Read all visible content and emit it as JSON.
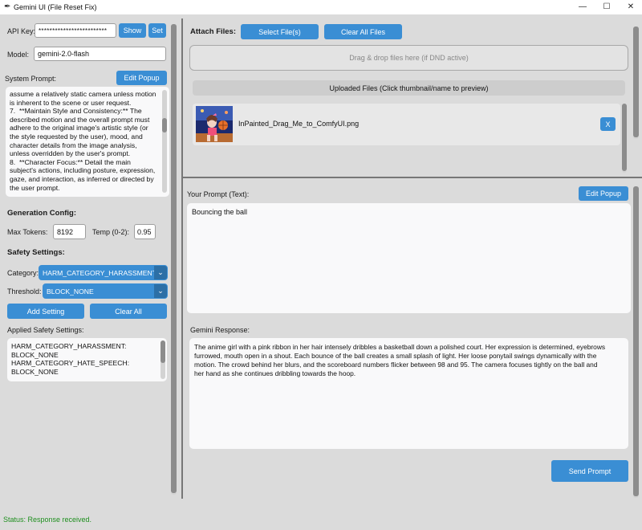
{
  "window": {
    "title": "Gemini UI (File Reset Fix)",
    "icon": "feather-icon",
    "controls": {
      "minimize": "—",
      "maximize": "☐",
      "close": "✕"
    }
  },
  "left": {
    "api_key_label": "API Key:",
    "api_key_value": "*************************",
    "show_label": "Show",
    "set_label": "Set",
    "model_label": "Model:",
    "model_value": "gemini-2.0-flash",
    "system_prompt_label": "System Prompt:",
    "edit_popup_label": "Edit Popup",
    "system_prompt_lines": [
      "assume a relatively static camera unless motion",
      "is inherent to the scene or user request.",
      "7.  **Maintain Style and Consistency:** The",
      "described motion and the overall prompt must",
      "adhere to the original image's artistic style (or",
      "the style requested by the user), mood, and",
      "character details from the image analysis,",
      "unless overridden by the user's prompt.",
      "8.  **Character Focus:** Detail the main",
      "subject's actions, including posture, expression,",
      "gaze, and interaction, as inferred or directed by",
      "the user prompt."
    ],
    "generation_config_label": "Generation Config:",
    "max_tokens_label": "Max Tokens:",
    "max_tokens_value": "8192",
    "temp_label": "Temp (0-2):",
    "temp_value": "0.95",
    "safety_settings_label": "Safety Settings:",
    "category_label": "Category:",
    "category_value": "HARM_CATEGORY_HARASSMENT",
    "threshold_label": "Threshold:",
    "threshold_value": "BLOCK_NONE",
    "add_setting_label": "Add Setting",
    "clear_all_label": "Clear All",
    "applied_label": "Applied Safety Settings:",
    "applied_lines": [
      "HARM_CATEGORY_HARASSMENT:",
      "BLOCK_NONE",
      "HARM_CATEGORY_HATE_SPEECH:",
      "BLOCK_NONE"
    ]
  },
  "attach": {
    "label": "Attach Files:",
    "select_files_label": "Select File(s)",
    "clear_all_files_label": "Clear All Files",
    "drop_hint": "Drag & drop files here (if DND active)",
    "uploaded_header": "Uploaded Files (Click thumbnail/name to preview)",
    "files": [
      {
        "name": "InPainted_Drag_Me_to_ComfyUI.png",
        "remove_label": "X"
      }
    ]
  },
  "prompt": {
    "label": "Your Prompt (Text):",
    "edit_popup_label": "Edit Popup",
    "value": "Bouncing the ball"
  },
  "response": {
    "label": "Gemini Response:",
    "lines": [
      "The anime girl with a pink ribbon in her hair intensely dribbles a basketball down a polished court. Her expression is determined, eyebrows",
      "furrowed, mouth open in a shout. Each bounce of the ball creates a small splash of light. Her loose ponytail swings dynamically with the",
      "motion. The crowd behind her blurs, and the scoreboard numbers flicker between 98 and 95. The camera focuses tightly on the ball and",
      "her hand as she continues dribbling towards the hoop."
    ],
    "send_label": "Send Prompt"
  },
  "status": {
    "text": "Status: Response received.",
    "color": "#1f8f1f"
  },
  "colors": {
    "accent": "#3a8ed4",
    "background": "#dbdbdb"
  }
}
